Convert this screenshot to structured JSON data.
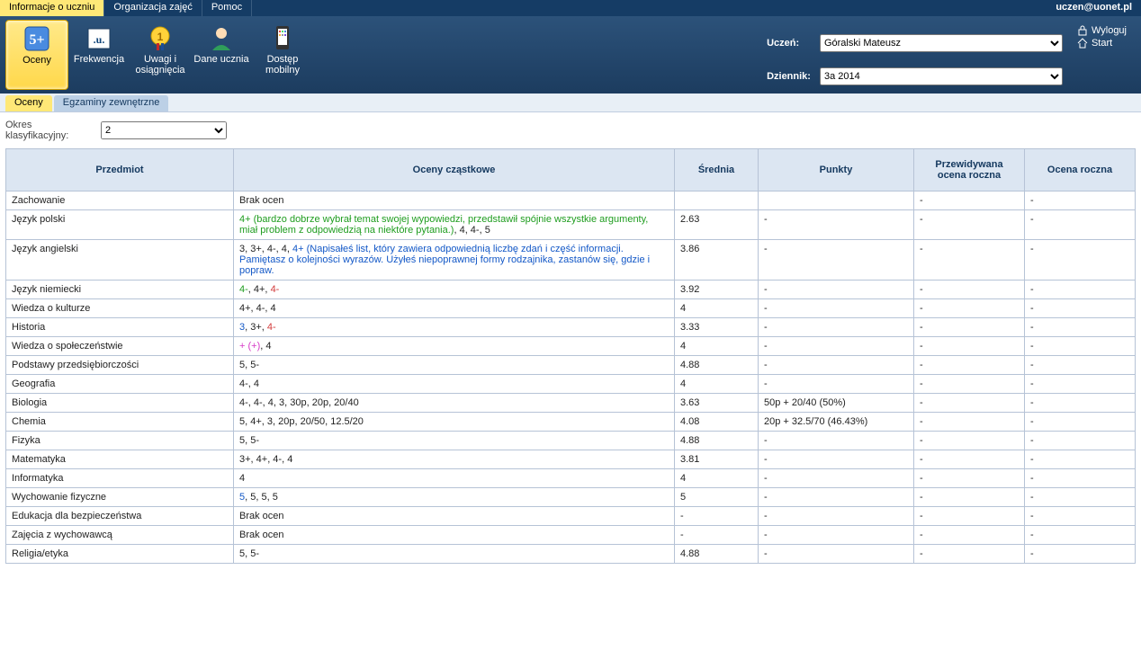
{
  "topbar": {
    "tabs": [
      "Informacje o uczniu",
      "Organizacja zajęć",
      "Pomoc"
    ],
    "active": 0,
    "email": "uczen@uonet.pl"
  },
  "ribbon": {
    "buttons": [
      {
        "label": "Oceny",
        "icon": "oceny"
      },
      {
        "label": "Frekwencja",
        "icon": "frekwencja"
      },
      {
        "label": "Uwagi i osiągnięcia",
        "icon": "uwagi"
      },
      {
        "label": "Dane ucznia",
        "icon": "dane"
      },
      {
        "label": "Dostęp mobilny",
        "icon": "mobilny"
      }
    ],
    "active": 0
  },
  "student": {
    "label": "Uczeń:",
    "options": [
      "Góralski Mateusz"
    ],
    "value": "Góralski Mateusz"
  },
  "journal": {
    "label": "Dziennik:",
    "options": [
      "3a 2014"
    ],
    "value": "3a 2014"
  },
  "user_actions": {
    "logout": "Wyloguj",
    "start": "Start"
  },
  "subtabs": {
    "tabs": [
      "Oceny",
      "Egzaminy zewnętrzne"
    ],
    "active": 0
  },
  "period": {
    "label": "Okres\nklasyfikacyjny:",
    "options": [
      "2"
    ],
    "value": "2"
  },
  "columns": [
    "Przedmiot",
    "Oceny cząstkowe",
    "Średnia",
    "Punkty",
    "Przewidywana ocena roczna",
    "Ocena roczna"
  ],
  "rows": [
    {
      "subject": "Zachowanie",
      "grades": [
        {
          "t": "Brak ocen"
        }
      ],
      "avg": "",
      "points": "",
      "pred": "-",
      "final": "-"
    },
    {
      "subject": "Język polski",
      "grades": [
        {
          "t": "4+ (bardzo dobrze wybrał temat swojej wypowiedzi, przedstawił spójnie wszystkie argumenty, miał problem z odpowiedzią na niektóre pytania.)",
          "c": "green"
        },
        {
          "t": ", 4, 4-, 5"
        }
      ],
      "avg": "2.63",
      "points": "-",
      "pred": "-",
      "final": "-"
    },
    {
      "subject": "Język angielski",
      "grades": [
        {
          "t": "3, 3+, 4-, 4, "
        },
        {
          "t": "4+ (Napisałeś list, który zawiera odpowiednią liczbę zdań i część informacji. Pamiętasz o kolejności wyrazów. Użyłeś niepoprawnej formy rodzajnika, zastanów się, gdzie i popraw.",
          "c": "blue"
        }
      ],
      "avg": "3.86",
      "points": "-",
      "pred": "-",
      "final": "-"
    },
    {
      "subject": "Język niemiecki",
      "grades": [
        {
          "t": "4-",
          "c": "green"
        },
        {
          "t": ", 4+, "
        },
        {
          "t": "4-",
          "c": "red"
        }
      ],
      "avg": "3.92",
      "points": "-",
      "pred": "-",
      "final": "-"
    },
    {
      "subject": "Wiedza o kulturze",
      "grades": [
        {
          "t": "4+, 4-, 4"
        }
      ],
      "avg": "4",
      "points": "-",
      "pred": "-",
      "final": "-"
    },
    {
      "subject": "Historia",
      "grades": [
        {
          "t": "3",
          "c": "blue"
        },
        {
          "t": ", 3+, "
        },
        {
          "t": "4-",
          "c": "red"
        }
      ],
      "avg": "3.33",
      "points": "-",
      "pred": "-",
      "final": "-"
    },
    {
      "subject": "Wiedza o społeczeństwie",
      "grades": [
        {
          "t": "+ (+)",
          "c": "magenta"
        },
        {
          "t": ", 4"
        }
      ],
      "avg": "4",
      "points": "-",
      "pred": "-",
      "final": "-"
    },
    {
      "subject": "Podstawy przedsiębiorczości",
      "grades": [
        {
          "t": "5, 5-"
        }
      ],
      "avg": "4.88",
      "points": "-",
      "pred": "-",
      "final": "-"
    },
    {
      "subject": "Geografia",
      "grades": [
        {
          "t": "4-, 4"
        }
      ],
      "avg": "4",
      "points": "-",
      "pred": "-",
      "final": "-"
    },
    {
      "subject": "Biologia",
      "grades": [
        {
          "t": "4-, 4-, 4, 3, 30p, 20p, 20/40"
        }
      ],
      "avg": "3.63",
      "points": "50p + 20/40 (50%)",
      "pred": "-",
      "final": "-"
    },
    {
      "subject": "Chemia",
      "grades": [
        {
          "t": "5, 4+, 3, 20p, 20/50, 12.5/20"
        }
      ],
      "avg": "4.08",
      "points": "20p + 32.5/70 (46.43%)",
      "pred": "-",
      "final": "-"
    },
    {
      "subject": "Fizyka",
      "grades": [
        {
          "t": "5, 5-"
        }
      ],
      "avg": "4.88",
      "points": "-",
      "pred": "-",
      "final": "-"
    },
    {
      "subject": "Matematyka",
      "grades": [
        {
          "t": "3+, 4+, 4-, 4"
        }
      ],
      "avg": "3.81",
      "points": "-",
      "pred": "-",
      "final": "-"
    },
    {
      "subject": "Informatyka",
      "grades": [
        {
          "t": "4"
        }
      ],
      "avg": "4",
      "points": "-",
      "pred": "-",
      "final": "-"
    },
    {
      "subject": "Wychowanie fizyczne",
      "grades": [
        {
          "t": "5",
          "c": "blue"
        },
        {
          "t": ", 5, 5, 5"
        }
      ],
      "avg": "5",
      "points": "-",
      "pred": "-",
      "final": "-"
    },
    {
      "subject": "Edukacja dla bezpieczeństwa",
      "grades": [
        {
          "t": "Brak ocen"
        }
      ],
      "avg": "-",
      "points": "-",
      "pred": "-",
      "final": "-"
    },
    {
      "subject": "Zajęcia z wychowawcą",
      "grades": [
        {
          "t": "Brak ocen"
        }
      ],
      "avg": "-",
      "points": "-",
      "pred": "-",
      "final": "-"
    },
    {
      "subject": "Religia/etyka",
      "grades": [
        {
          "t": "5, 5-"
        }
      ],
      "avg": "4.88",
      "points": "-",
      "pred": "-",
      "final": "-"
    }
  ]
}
